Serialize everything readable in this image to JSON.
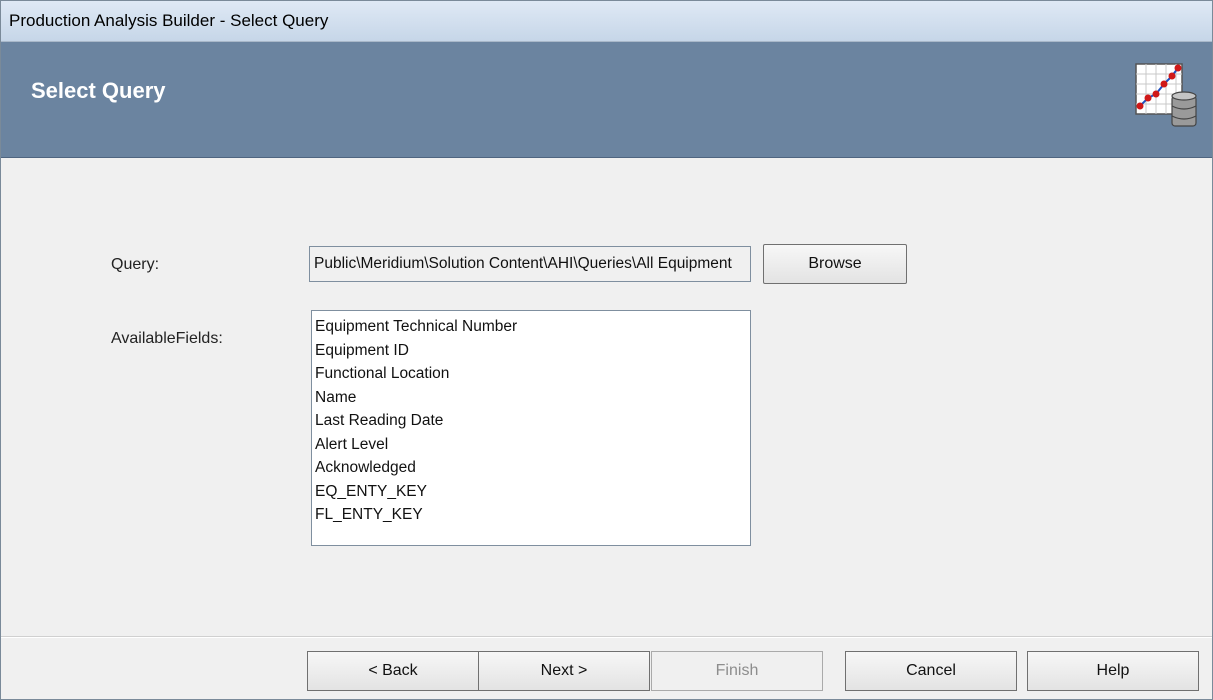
{
  "window": {
    "title": "Production Analysis Builder - Select Query"
  },
  "header": {
    "heading": "Select Query",
    "logo_icon": "chart-database-icon"
  },
  "form": {
    "query_label": "Query:",
    "query_value": "Public\\Meridium\\Solution Content\\AHI\\Queries\\All Equipment",
    "browse_label": "Browse",
    "fields_label": "AvailableFields:",
    "fields": [
      "Equipment Technical Number",
      "Equipment ID",
      "Functional Location",
      "Name",
      "Last Reading Date",
      "Alert Level",
      "Acknowledged",
      "EQ_ENTY_KEY",
      "FL_ENTY_KEY"
    ]
  },
  "footer": {
    "back_label": "< Back",
    "next_label": "Next >",
    "finish_label": "Finish",
    "cancel_label": "Cancel",
    "help_label": "Help"
  },
  "colors": {
    "header_bg": "#6b84a0",
    "window_bg": "#f0f0f0",
    "disabled_text": "#8d8d8d"
  }
}
